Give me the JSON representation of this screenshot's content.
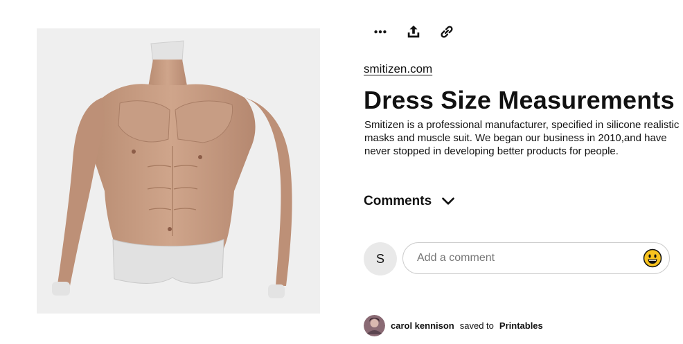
{
  "pin": {
    "image_alt": "Silicone muscle suit torso",
    "source": "smitizen.com",
    "title": "Dress Size Measurements",
    "description": "Smitizen is a professional manufacturer, specified in silicone realistic masks and muscle suit. We began our business in 2010,and have never stopped in developing better products for people."
  },
  "actions": {
    "more_icon": "more-horizontal-icon",
    "share_icon": "share-upload-icon",
    "link_icon": "link-icon"
  },
  "comments": {
    "label": "Comments",
    "user_initial": "S",
    "placeholder": "Add a comment",
    "emoji_icon": "smiley-emoji-icon"
  },
  "saved_by": {
    "user": "carol kennison",
    "text": "saved to",
    "board": "Printables"
  },
  "colors": {
    "image_background": "#efefef",
    "skin": "#c39a81",
    "emoji_yellow": "#f7c21e"
  }
}
